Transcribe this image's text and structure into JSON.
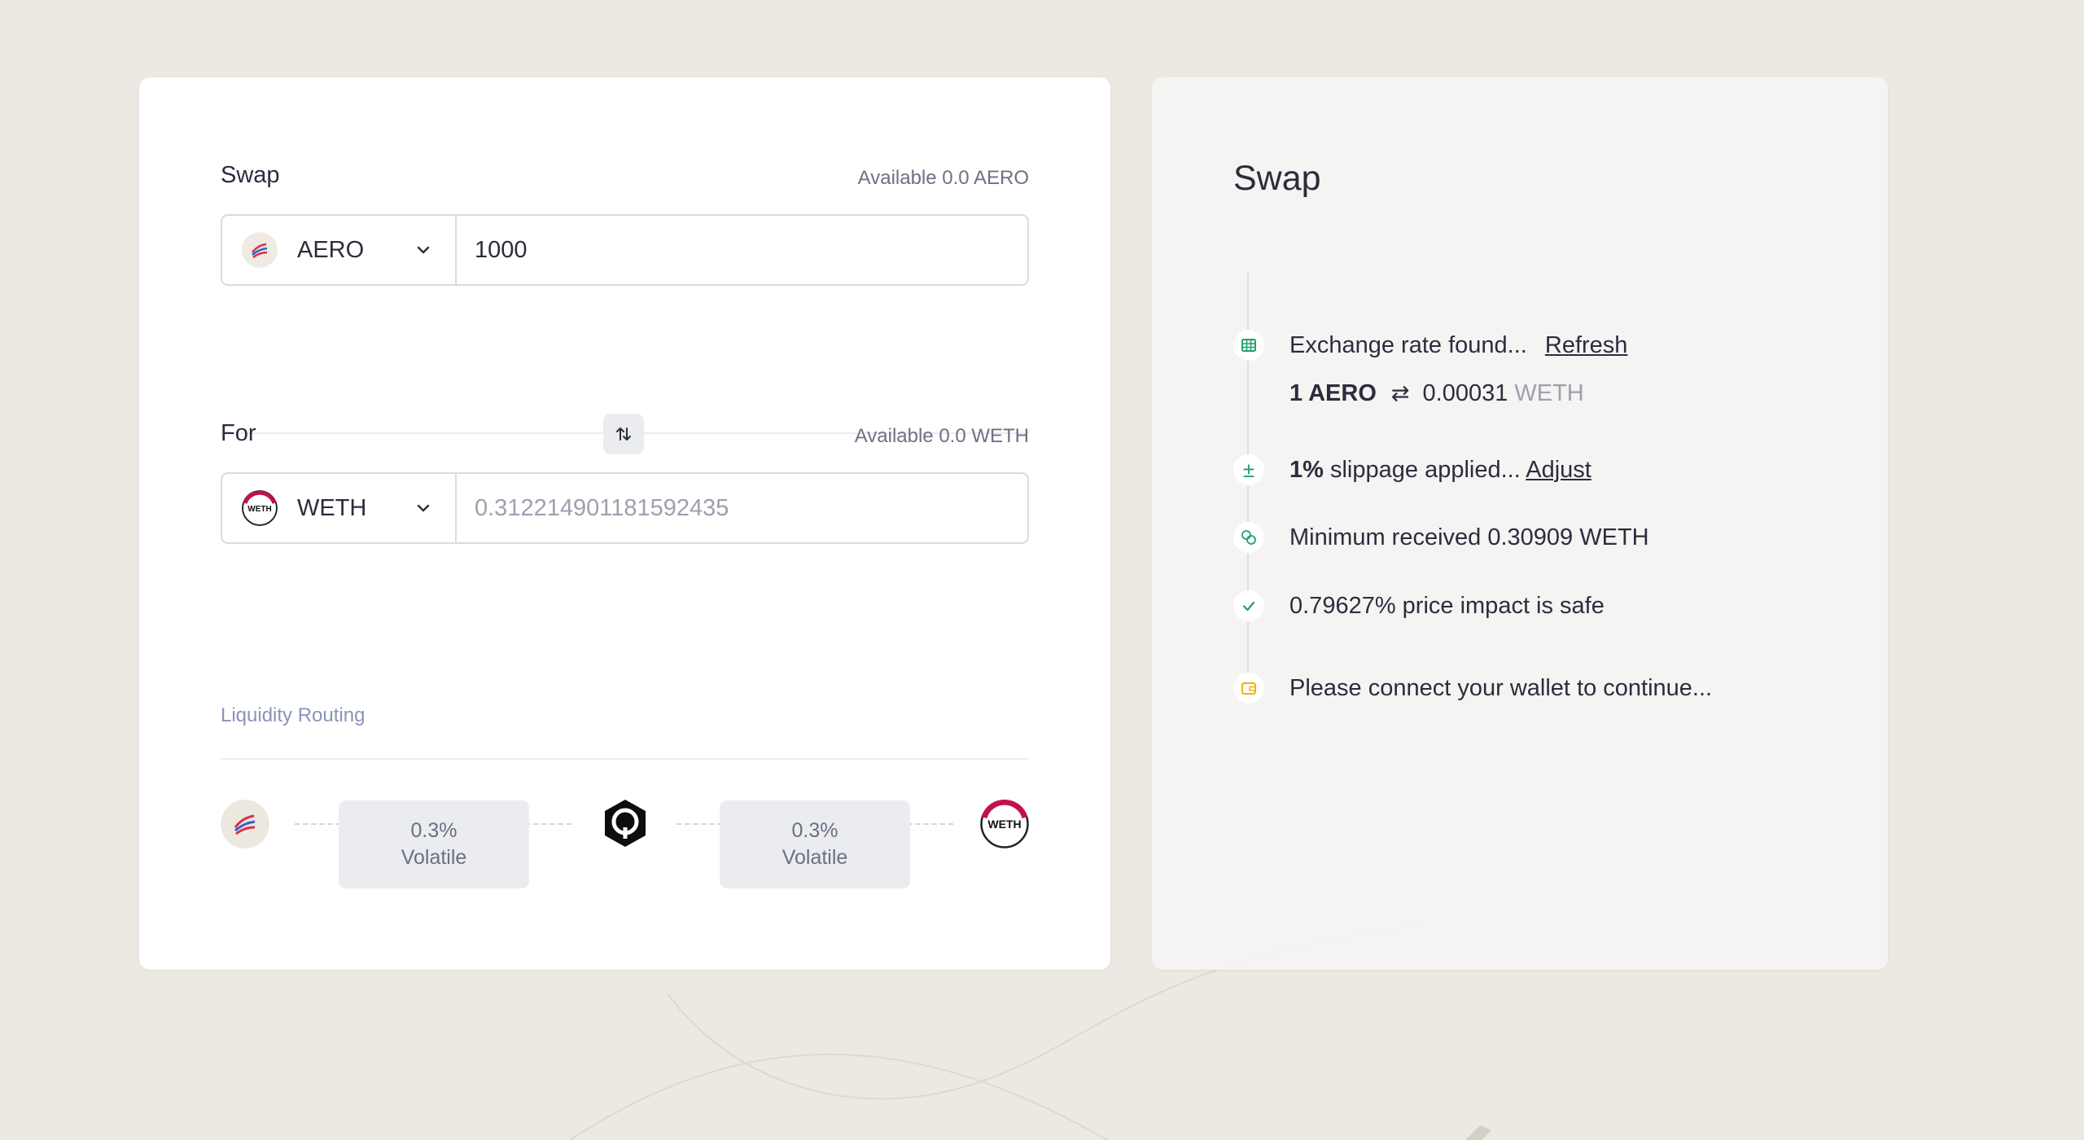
{
  "swap": {
    "label": "Swap",
    "from_available": "Available 0.0 AERO",
    "from_token": "AERO",
    "from_amount": "1000",
    "for_label": "For",
    "to_available": "Available 0.0 WETH",
    "to_token": "WETH",
    "to_amount": "0.312214901181592435"
  },
  "routing": {
    "label": "Liquidity Routing",
    "hops": [
      {
        "fee": "0.3%",
        "type": "Volatile"
      },
      {
        "fee": "0.3%",
        "type": "Volatile"
      }
    ],
    "logo_weth_text": "WETH"
  },
  "summary": {
    "title": "Swap",
    "exchange_text": "Exchange rate found...",
    "refresh_label": "Refresh",
    "rate_from": "1 AERO",
    "rate_value": "0.00031",
    "rate_unit": "WETH",
    "slippage_value": "1%",
    "slippage_text": "slippage applied...",
    "adjust_label": "Adjust",
    "minimum_text": "Minimum received 0.30909 WETH",
    "impact_text": "0.79627% price impact is safe",
    "connect_text": "Please connect your wallet to continue..."
  },
  "colors": {
    "accent_green": "#23a06b",
    "warning_yellow": "#f2b200",
    "weth_red": "#c0124a"
  }
}
